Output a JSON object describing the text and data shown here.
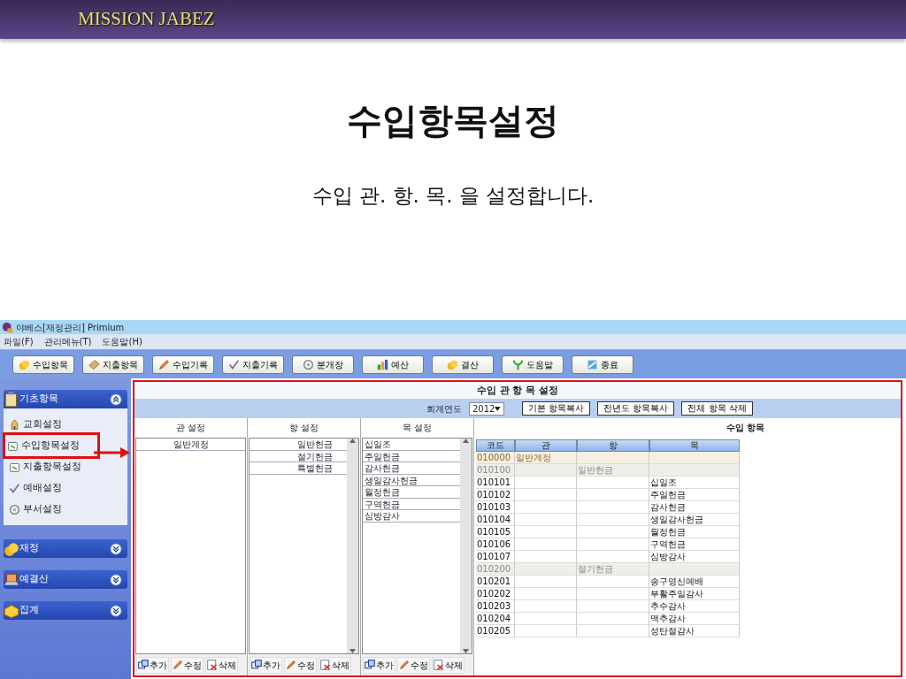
{
  "slide": {
    "brand": "MISSION JABEZ",
    "title": "수입항목설정",
    "subtitle": "수입 관. 항. 목. 을 설정합니다."
  },
  "window": {
    "title": "야베스[재정관리]  Primium"
  },
  "menu": [
    "파일(F)",
    "관리메뉴(T)",
    "도움말(H)"
  ],
  "toolbar": [
    "수입항목",
    "지출항목",
    "수입기록",
    "지출기록",
    "분개장",
    "예산",
    "결산",
    "도움말",
    "종료"
  ],
  "sidebar": [
    {
      "label": "기초항목",
      "expanded": true,
      "items": [
        {
          "label": "교회설정",
          "highlighted": false
        },
        {
          "label": "수입항목설정",
          "highlighted": true
        },
        {
          "label": "지출항목설정",
          "highlighted": false
        },
        {
          "label": "예배설정",
          "highlighted": false
        },
        {
          "label": "부서설정",
          "highlighted": false
        }
      ]
    },
    {
      "label": "재정",
      "expanded": false
    },
    {
      "label": "예결산",
      "expanded": false
    },
    {
      "label": "집계",
      "expanded": false
    }
  ],
  "panel": {
    "title": "수입 관 항 목 설정",
    "year_label": "회계연도",
    "year": "2012",
    "buttons": [
      "기본 항목복사",
      "전년도 항목복사",
      "전체 항목 삭제"
    ],
    "lists": [
      {
        "kind": "gwan",
        "title": "관 설정",
        "items": [
          "일반계정"
        ],
        "buttons": [
          "추가",
          "수정",
          "삭제"
        ]
      },
      {
        "kind": "hang",
        "title": "항 설정",
        "items": [
          "일반헌금",
          "절기헌금",
          "특별헌금"
        ],
        "buttons": [
          "추가",
          "수정",
          "삭제"
        ]
      },
      {
        "kind": "mok",
        "title": "목 설정",
        "items": [
          "십일조",
          "주일헌금",
          "감사헌금",
          "생일감사헌금",
          "월정헌금",
          "구역헌금",
          "심방감사"
        ],
        "buttons": [
          "추가",
          "수정",
          "삭제"
        ]
      }
    ],
    "table": {
      "title": "수입 항목",
      "columns": [
        "코드",
        "관",
        "항",
        "목"
      ],
      "rows": [
        {
          "kind": "gwan",
          "code": "010000",
          "name": "일반계정"
        },
        {
          "kind": "hang",
          "code": "010100",
          "name": "일반헌금"
        },
        {
          "kind": "mok",
          "code": "010101",
          "name": "십일조"
        },
        {
          "kind": "mok",
          "code": "010102",
          "name": "주일헌금"
        },
        {
          "kind": "mok",
          "code": "010103",
          "name": "감사헌금"
        },
        {
          "kind": "mok",
          "code": "010104",
          "name": "생일감사헌금"
        },
        {
          "kind": "mok",
          "code": "010105",
          "name": "월정헌금"
        },
        {
          "kind": "mok",
          "code": "010106",
          "name": "구역헌금"
        },
        {
          "kind": "mok",
          "code": "010107",
          "name": "심방감사"
        },
        {
          "kind": "hang",
          "code": "010200",
          "name": "절기헌금"
        },
        {
          "kind": "mok",
          "code": "010201",
          "name": "송구영신예배"
        },
        {
          "kind": "mok",
          "code": "010202",
          "name": "부활주일감사"
        },
        {
          "kind": "mok",
          "code": "010203",
          "name": "추수감사"
        },
        {
          "kind": "mok",
          "code": "010204",
          "name": "맥추감사"
        },
        {
          "kind": "mok",
          "code": "010205",
          "name": "성탄절감사"
        }
      ]
    }
  }
}
